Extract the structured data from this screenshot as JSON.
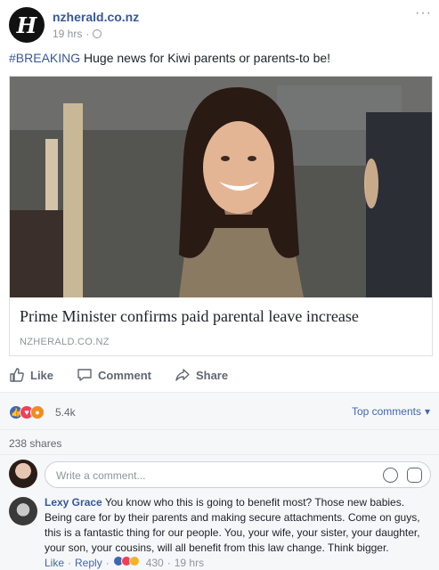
{
  "post": {
    "page_name": "nzherald.co.nz",
    "logo_letter": "H",
    "time": "19 hrs",
    "more": "···",
    "hashtag": "#BREAKING",
    "text": " Huge news for Kiwi parents or parents-to be!"
  },
  "link": {
    "title": "Prime Minister confirms paid parental leave increase",
    "domain": "NZHERALD.CO.NZ"
  },
  "actions": {
    "like": "Like",
    "comment": "Comment",
    "share": "Share"
  },
  "reactions": {
    "count": "5.4k",
    "top_comments": "Top comments",
    "colors": {
      "like": "#4267b2",
      "love": "#f33e58",
      "angry": "#f28c1f"
    }
  },
  "shares": {
    "text": "238 shares"
  },
  "compose": {
    "placeholder": "Write a comment..."
  },
  "comment": {
    "author": "Lexy Grace",
    "text": " You know who this is going to benefit most? Those new babies. Being care for by their parents and making secure attachments. Come on guys, this is a fantastic thing for our people. You, your wife, your sister, your daughter, your son, your cousins, will all benefit from this law change. Think bigger.",
    "like": "Like",
    "separator": "·",
    "reply": "Reply",
    "reaction_count": "430",
    "time": "19 hrs"
  },
  "accent_color": "#365899"
}
